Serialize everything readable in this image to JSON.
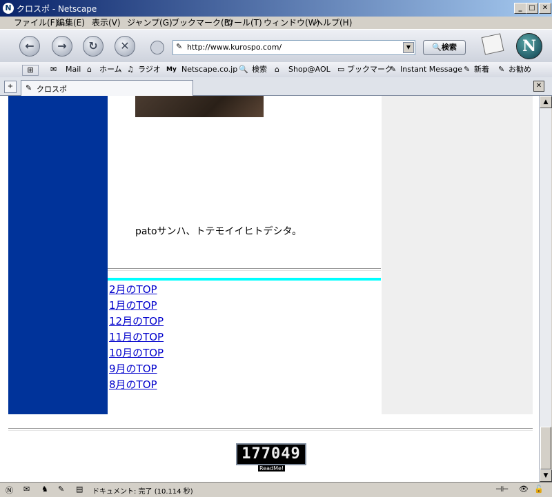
{
  "window": {
    "title": "クロスポ - Netscape",
    "app_icon": "netscape-icon",
    "btn_min": "_",
    "btn_max": "□",
    "btn_close": "✕"
  },
  "menu": {
    "items": [
      "ファイル(F)",
      "編集(E)",
      "表示(V)",
      "ジャンプ(G)",
      "ブックマーク(B)",
      "ツール(T)",
      "ウィンドウ(W)",
      "ヘルプ(H)"
    ]
  },
  "nav": {
    "back": "←",
    "forward": "→",
    "reload": "↻",
    "stop": "✕",
    "url": "http://www.kurospo.com/",
    "search_label": "検索",
    "logo": "N"
  },
  "personal_bar": {
    "items": [
      "Mail",
      "ホーム",
      "ラジオ",
      "Netscape.co.jp",
      "検索",
      "Shop@AOL",
      "ブックマーク",
      "Instant Message",
      "新着",
      "お勧め"
    ]
  },
  "tabs": {
    "active_label": "クロスポ",
    "close": "✕"
  },
  "page": {
    "body_text": "patoサンハ、トテモイイヒトデシタ。",
    "links": [
      "2月のTOP",
      "1月のTOP",
      "12月のTOP",
      "11月のTOP",
      "10月のTOP",
      "9月のTOP",
      "8月のTOP"
    ],
    "counter_value": "177049",
    "counter_label": "ReadMe!"
  },
  "status": {
    "text": "ドキュメント: 完了 (10.114 秒)"
  },
  "colors": {
    "sidebar_blue": "#00339a",
    "cyan": "#00ffff",
    "link": "#0000cc",
    "right_gray": "#efefef"
  }
}
